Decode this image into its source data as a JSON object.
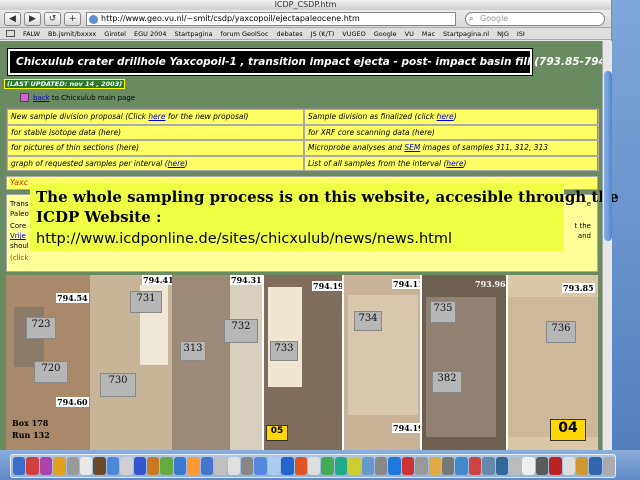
{
  "window": {
    "title": "ICDP_CSDP.htm"
  },
  "toolbar": {
    "back_label": "◀",
    "forward_label": "▶",
    "reload_label": "↺",
    "add_label": "+",
    "url": "http://www.geo.vu.nl/~smit/csdp/yaxcopoil/ejectapaleocene.htm",
    "search_placeholder": "Google"
  },
  "bookmarks": [
    "FALW",
    "Bb.jsmit/bxxxx",
    "Girotel",
    "EGU 2004",
    "Startpagina",
    "forum GeolSoc",
    "debates",
    "JS (K/T)",
    "VUGEO",
    "Google",
    "VU",
    "Mac",
    "Startpagina.nl",
    "NJG",
    "ISI"
  ],
  "page": {
    "title": "Chicxulub crater drillhole Yaxcopoil-1 , transition impact ejecta - post- impact basin fill (793.85-794.60m)",
    "last_updated": "(LAST UPDATED: nov 14 , 2003)",
    "back_link": "back",
    "back_text": " to Chicxulub main page"
  },
  "menu": [
    {
      "pre": "New sample division proposal (Click ",
      "link": "here",
      "post": " for the new proposal)"
    },
    {
      "pre": "Sample division as finalized (click ",
      "link": "here",
      "post": ")"
    },
    {
      "pre": "for stable isotope data (here)",
      "link": "",
      "post": ""
    },
    {
      "pre": "for XRF core scanning data (here)",
      "link": "",
      "post": ""
    },
    {
      "pre": "for pictures of thin sections (here)",
      "link": "",
      "post": ""
    },
    {
      "pre": "Microprobe analyses and ",
      "link": "SEM",
      "post": " images of samples 311, 312, 313"
    },
    {
      "pre": "graph of requested samples per interval (",
      "link": "here",
      "post": ")"
    },
    {
      "pre": "List of all samples from the interval (",
      "link": "here",
      "post": ")"
    }
  ],
  "strip": {
    "text": "Yaxc"
  },
  "text_block": {
    "line1": "Trans",
    "line1_right": "e",
    "line2": "Paleo",
    "line3": "Core",
    "line3_right": "t the",
    "line4_link": "Vrije",
    "line4_right": "and",
    "line5": "shoul",
    "line6": "(click"
  },
  "overlay": {
    "line1": "The whole sampling process is on this website, accesible through the ICDP Website :",
    "line1a": "The whole sampling process is on this website, accesible through the",
    "line1b": "ICDP Website :",
    "line2": "http://www.icdponline.de/sites/chicxulub/news/news.html"
  },
  "cores": [
    {
      "top": "794.54",
      "bottom": "794.60",
      "tags": [
        "723",
        "720"
      ]
    },
    {
      "top": "794.41",
      "tags": [
        "731",
        "730"
      ]
    },
    {
      "top": "794.31",
      "tags": [
        "732",
        "313"
      ]
    },
    {
      "top": "794.19",
      "tags": [
        "733"
      ]
    },
    {
      "top": "794.11",
      "bottom": "794.19",
      "tags": [
        "734"
      ]
    },
    {
      "top": "793.96",
      "tags": [
        "735",
        "382"
      ]
    },
    {
      "top": "793.85",
      "tags": [
        "736",
        "04"
      ]
    }
  ],
  "box_label": {
    "box": "Box 178",
    "run": "Run 132"
  },
  "colors": {
    "page_bg": "#6a8a62",
    "menu_bg": "#ffff66",
    "overlay_bg": "#eeff44",
    "link": "#0000cc"
  }
}
